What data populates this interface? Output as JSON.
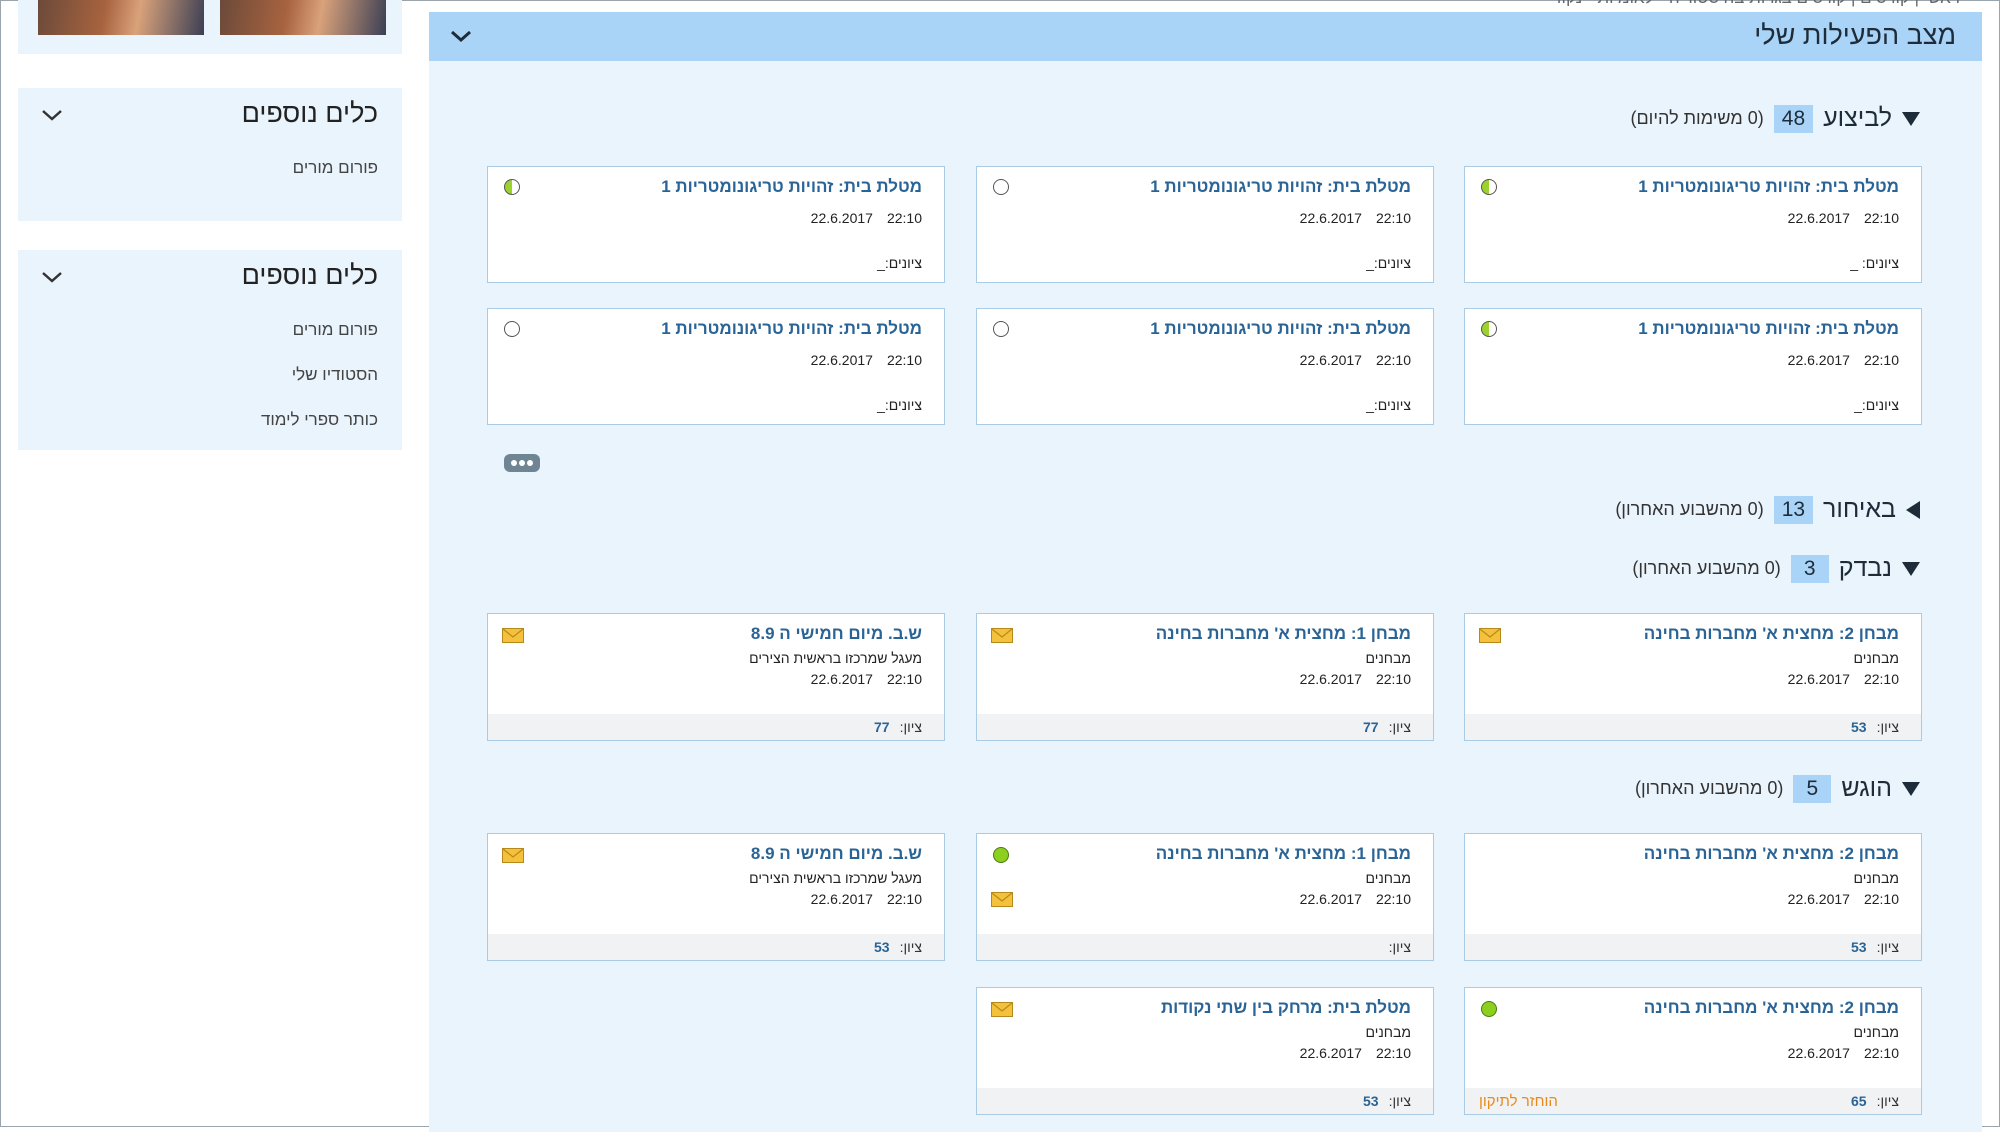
{
  "breadcrumb": "ראשי  |  קורסים  |  קורסים בגרות בהיסטוריה - לאומיות - נקוד",
  "left": {
    "boxes": [
      {
        "title": "כלים נוספים",
        "items": [
          "פורום מורים"
        ]
      },
      {
        "title": "כלים נוספים",
        "items": [
          "פורום מורים",
          "הסטודיו שלי",
          "כותר ספרי לימוד"
        ]
      }
    ]
  },
  "panel": {
    "title": "מצב הפעילות שלי",
    "sections": {
      "todo": {
        "title": "לביצוע",
        "count": "48",
        "note": "(0 משימות להיום)"
      },
      "late": {
        "title": "באיחור",
        "count": "13",
        "note": "(0 מהשבוע האחרון)"
      },
      "checked": {
        "title": "נבדק",
        "count": "3",
        "note": "(0 מהשבוע האחרון)"
      },
      "submitted": {
        "title": "הוגש",
        "count": "5",
        "note": "(0 מהשבוע האחרון)"
      }
    }
  },
  "todo_cards": [
    {
      "title": "מטלת בית: זהויות טריגונומטריות 1",
      "date": "22.6.2017",
      "time": "22:10",
      "grade": "ציונים: _",
      "status": "half"
    },
    {
      "title": "מטלת בית: זהויות טריגונומטריות 1",
      "date": "22.6.2017",
      "time": "22:10",
      "grade": "ציונים:_",
      "status": "empty"
    },
    {
      "title": "מטלת בית: זהויות טריגונומטריות 1",
      "date": "22.6.2017",
      "time": "22:10",
      "grade": "ציונים:_",
      "status": "half"
    },
    {
      "title": "מטלת בית: זהויות טריגונומטריות 1",
      "date": "22.6.2017",
      "time": "22:10",
      "grade": "ציונים:_",
      "status": "half"
    },
    {
      "title": "מטלת בית: זהויות טריגונומטריות 1",
      "date": "22.6.2017",
      "time": "22:10",
      "grade": "ציונים:_",
      "status": "empty"
    },
    {
      "title": "מטלת בית: זהויות טריגונומטריות 1",
      "date": "22.6.2017",
      "time": "22:10",
      "grade": "ציונים:_",
      "status": "empty"
    }
  ],
  "checked_cards": [
    {
      "title": "מבחן 2: מחצית א' מחברות בחינה",
      "sub": "מבחנים",
      "date": "22.6.2017",
      "time": "22:10",
      "grade_label": "ציון:",
      "grade": "53"
    },
    {
      "title": "מבחן 1: מחצית א' מחברות בחינה",
      "sub": "מבחנים",
      "date": "22.6.2017",
      "time": "22:10",
      "grade_label": "ציון:",
      "grade": "77"
    },
    {
      "title": "ש.ב. מיום חמישי ה 8.9",
      "sub": "מעגל שמרכזו בראשית הצירים",
      "date": "22.6.2017",
      "time": "22:10",
      "grade_label": "ציון:",
      "grade": "77"
    }
  ],
  "submitted_cards": [
    {
      "title": "מבחן 2: מחצית א' מחברות בחינה",
      "sub": "מבחנים",
      "date": "22.6.2017",
      "time": "22:10",
      "grade_label": "ציון:",
      "grade": "53"
    },
    {
      "title": "מבחן 1: מחצית א' מחברות בחינה",
      "sub": "מבחנים",
      "date": "22.6.2017",
      "time": "22:10",
      "grade_label": "ציון:",
      "grade": ""
    },
    {
      "title": "ש.ב. מיום חמישי ה 8.9",
      "sub": "מעגל שמרכזו בראשית הצירים",
      "date": "22.6.2017",
      "time": "22:10",
      "grade_label": "ציון:",
      "grade": "53"
    },
    {
      "title": "מבחן 2: מחצית א' מחברות בחינה",
      "sub": "מבחנים",
      "date": "22.6.2017",
      "time": "22:10",
      "grade_label": "ציון:",
      "grade": "65",
      "returned": "הוחזר לתיקון"
    },
    {
      "title": "מטלת בית: מרחק בין שתי נקודות",
      "sub": "מבחנים",
      "date": "22.6.2017",
      "time": "22:10",
      "grade_label": "ציון:",
      "grade": "53"
    }
  ],
  "colors": {
    "header": "#a9d4f7",
    "panel_bg": "#eaf4fd",
    "link": "#2a6496",
    "returned": "#e88a1a"
  }
}
